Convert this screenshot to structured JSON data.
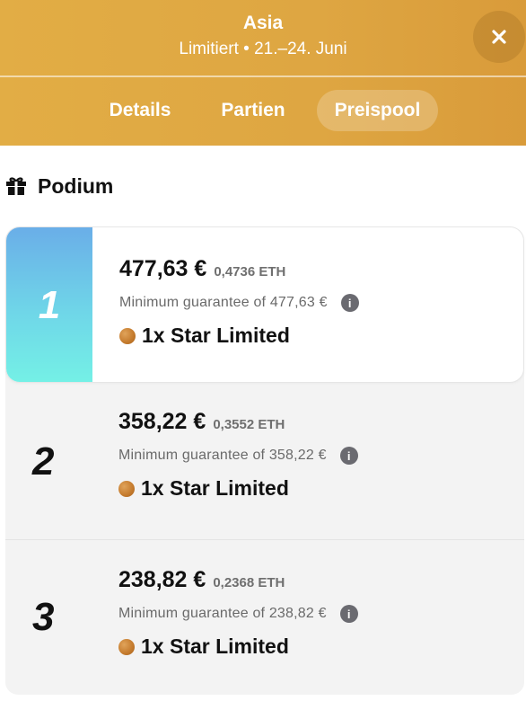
{
  "header": {
    "title": "Asia",
    "subtitle": "Limitiert • 21.–24. Juni",
    "close_icon": "close-icon"
  },
  "tabs": [
    {
      "label": "Details",
      "active": false
    },
    {
      "label": "Partien",
      "active": false
    },
    {
      "label": "Preispool",
      "active": true
    }
  ],
  "section": {
    "icon": "gift-icon",
    "title": "Podium"
  },
  "podium": [
    {
      "rank": "1",
      "price": "477,63 €",
      "eth": "0,4736 ETH",
      "guarantee": "Minimum guarantee of 477,63 €",
      "reward": "1x Star Limited"
    },
    {
      "rank": "2",
      "price": "358,22 €",
      "eth": "0,3552 ETH",
      "guarantee": "Minimum guarantee of 358,22 €",
      "reward": "1x Star Limited"
    },
    {
      "rank": "3",
      "price": "238,82 €",
      "eth": "0,2368 ETH",
      "guarantee": "Minimum guarantee of 238,82 €",
      "reward": "1x Star Limited"
    }
  ],
  "colors": {
    "header_gold": "#dea642",
    "first_place_gradient_top": "#6aaee8",
    "first_place_gradient_bottom": "#74f0e6",
    "coin": "#c47a2c"
  }
}
